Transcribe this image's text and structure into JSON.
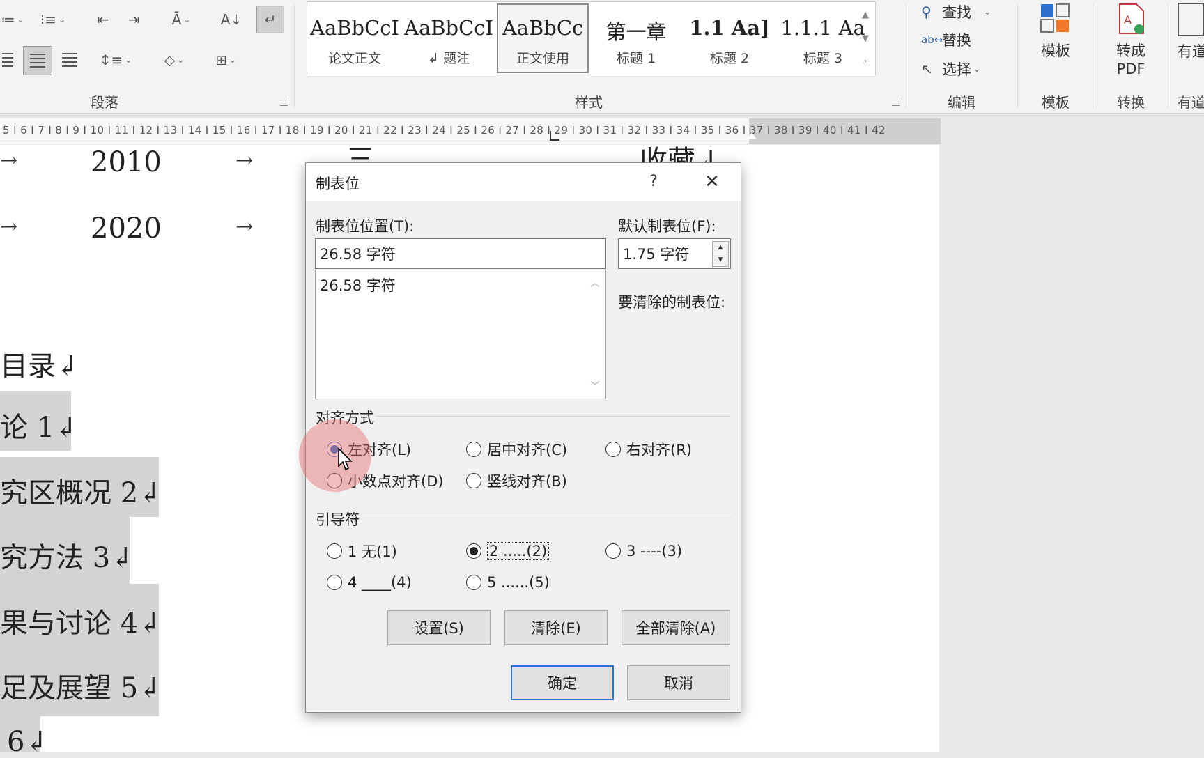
{
  "ribbon": {
    "paragraph_group_label": "段落",
    "styles_group_label": "样式",
    "editing_group_label": "编辑",
    "template_group_label": "模板",
    "convert_group_label": "转换",
    "youdao_group_label": "有道",
    "styles": [
      {
        "sample": "AaBbCcI",
        "name": "论文正文",
        "selected": false
      },
      {
        "sample": "AaBbCcI",
        "name": "↲ 题注",
        "selected": false
      },
      {
        "sample": "AaBbCc",
        "name": "正文使用",
        "selected": true
      },
      {
        "sample": "第一章",
        "name": "标题 1",
        "selected": false
      },
      {
        "sample": "1.1  Aa]",
        "name": "标题 2",
        "selected": false
      },
      {
        "sample": "1.1.1  Aa",
        "name": "标题 3",
        "selected": false
      }
    ],
    "edit": {
      "find": "查找",
      "replace": "替换",
      "select": "选择"
    },
    "template_button": "模板",
    "to_pdf_button_line1": "转成",
    "to_pdf_button_line2": "PDF",
    "youdao_button": "有道"
  },
  "ruler": {
    "numbers": "5 I 6 I 7 I 8 I 9 I 10 I 11 I 12 I 13 I 14 I 15 I 16 I 17 I 18 I 19 I 20 I 21 I 22 I 23 I 24 I 25 I 26 I 27 I 28 I 29 I 30 I 31 I 32 I 33 I 34 I 35 I 36 I 37 I 38 I 39 I 40 I 41 I 42"
  },
  "document": {
    "year_rows": [
      "2010",
      "2020"
    ],
    "tab_arrow": "→",
    "partial_right_text": "收藏↲",
    "partial_mid_text": "三",
    "toc_title": "目录↲",
    "toc_lines": [
      "论 1↲",
      "究区概况 2↲",
      "究方法 3↲",
      "果与讨论 4↲",
      "足及展望 5↲",
      "6↲"
    ]
  },
  "dialog": {
    "title": "制表位",
    "help": "?",
    "tab_position_label": "制表位位置(T):",
    "tab_position_value": "26.58 字符",
    "tab_list_items": [
      "26.58 字符"
    ],
    "default_tab_label": "默认制表位(F):",
    "default_tab_value": "1.75 字符",
    "clear_label": "要清除的制表位:",
    "alignment_label": "对齐方式",
    "alignment_options": [
      {
        "label": "左对齐(L)",
        "checked": true
      },
      {
        "label": "居中对齐(C)",
        "checked": false
      },
      {
        "label": "右对齐(R)",
        "checked": false
      },
      {
        "label": "小数点对齐(D)",
        "checked": false
      },
      {
        "label": "竖线对齐(B)",
        "checked": false
      }
    ],
    "leader_label": "引导符",
    "leader_options": [
      {
        "label": "1 无(1)",
        "checked": false
      },
      {
        "label": "2 .....(2)",
        "checked": true
      },
      {
        "label": "3 ----(3)",
        "checked": false
      },
      {
        "label": "4 ____(4)",
        "checked": false
      },
      {
        "label": "5 ......(5)",
        "checked": false
      }
    ],
    "buttons": {
      "set": "设置(S)",
      "clear": "清除(E)",
      "clear_all": "全部清除(A)",
      "ok": "确定",
      "cancel": "取消"
    }
  }
}
